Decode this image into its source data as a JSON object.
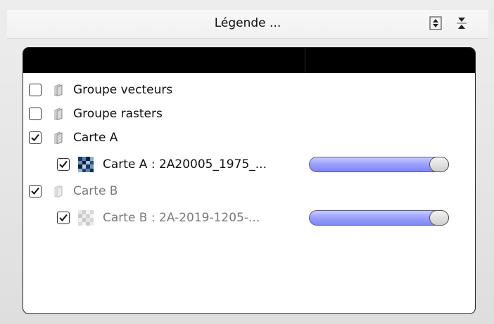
{
  "header": {
    "title": "Légende ...",
    "expand_icon": "expand-all-icon",
    "collapse_icon": "collapse-all-icon"
  },
  "legend": {
    "items": [
      {
        "label": "Groupe vecteurs",
        "checked": false,
        "kind": "group",
        "dimmed": false
      },
      {
        "label": "Groupe rasters",
        "checked": false,
        "kind": "group",
        "dimmed": false
      },
      {
        "label": "Carte A",
        "checked": true,
        "kind": "group",
        "dimmed": false
      },
      {
        "label": "Carte A : 2A20005_1975_...",
        "checked": true,
        "kind": "raster",
        "dimmed": false,
        "opacity": 0.95
      },
      {
        "label": "Carte B",
        "checked": true,
        "kind": "group",
        "dimmed": true
      },
      {
        "label": "Carte B : 2A-2019-1205-...",
        "checked": true,
        "kind": "raster",
        "dimmed": true,
        "opacity": 0.95
      }
    ]
  },
  "colors": {
    "slider_fill": "#8e94f6",
    "panel_header": "#000000"
  }
}
